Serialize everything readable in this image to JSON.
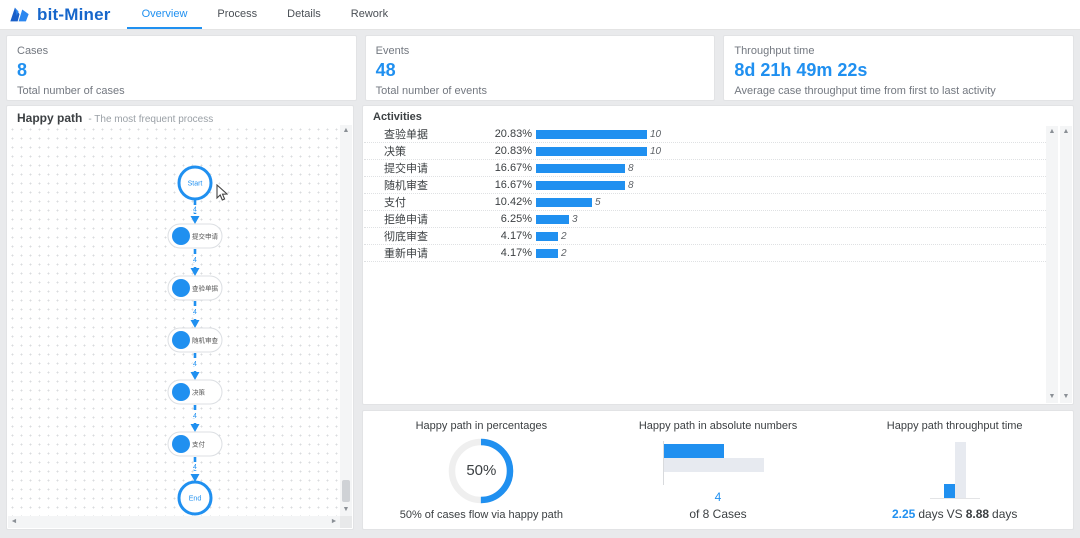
{
  "colors": {
    "accent": "#2090f0",
    "logo": "#1666cb",
    "bar_gray": "#e7eaf0"
  },
  "header": {
    "logo_text": "bit-Miner",
    "tabs": [
      {
        "label": "Overview",
        "active": true
      },
      {
        "label": "Process",
        "active": false
      },
      {
        "label": "Details",
        "active": false
      },
      {
        "label": "Rework",
        "active": false
      }
    ]
  },
  "summary_cards": [
    {
      "label": "Cases",
      "value": "8",
      "description": "Total number of cases"
    },
    {
      "label": "Events",
      "value": "48",
      "description": "Total number of events"
    },
    {
      "label": "Throughput time",
      "value": "8d 21h 49m 22s",
      "description": "Average case throughput time from first to last activity"
    }
  ],
  "happy_path": {
    "title": "Happy path",
    "subtitle": "- The most frequent process",
    "edge_label": "4",
    "nodes": [
      "Start",
      "提交申请",
      "查验单据",
      "随机审查",
      "决策",
      "支付",
      "End"
    ]
  },
  "activities": {
    "title": "Activities",
    "rows": [
      {
        "label": "查验单据",
        "percent": "20.83%",
        "value": 10
      },
      {
        "label": "决策",
        "percent": "20.83%",
        "value": 10
      },
      {
        "label": "提交申请",
        "percent": "16.67%",
        "value": 8
      },
      {
        "label": "随机审查",
        "percent": "16.67%",
        "value": 8
      },
      {
        "label": "支付",
        "percent": "10.42%",
        "value": 5
      },
      {
        "label": "拒绝申请",
        "percent": "6.25%",
        "value": 3
      },
      {
        "label": "彻底审查",
        "percent": "4.17%",
        "value": 2
      },
      {
        "label": "重新申请",
        "percent": "4.17%",
        "value": 2
      }
    ]
  },
  "happy_path_stats": {
    "percentages": {
      "title": "Happy path in percentages",
      "percent": 50,
      "center_label": "50%",
      "caption": "50% of cases flow via happy path"
    },
    "absolute": {
      "title": "Happy path in absolute numbers",
      "happy": 4,
      "total": 8,
      "value_label": "4",
      "caption": "of 8 Cases"
    },
    "throughput": {
      "title": "Happy path throughput time",
      "happy_days": "2.25",
      "total_days": "8.88",
      "unit": "days",
      "vs": "VS"
    }
  },
  "chart_data": [
    {
      "type": "bar",
      "title": "Activities",
      "orientation": "horizontal",
      "categories": [
        "查验单据",
        "决策",
        "提交申请",
        "随机审查",
        "支付",
        "拒绝申请",
        "彻底审查",
        "重新申请"
      ],
      "values": [
        10,
        10,
        8,
        8,
        5,
        3,
        2,
        2
      ],
      "percent_labels": [
        "20.83%",
        "20.83%",
        "16.67%",
        "16.67%",
        "10.42%",
        "6.25%",
        "4.17%",
        "4.17%"
      ]
    },
    {
      "type": "pie",
      "title": "Happy path in percentages",
      "categories": [
        "happy path",
        "other"
      ],
      "values": [
        50,
        50
      ],
      "center_label": "50%"
    },
    {
      "type": "bar",
      "title": "Happy path in absolute numbers",
      "orientation": "horizontal",
      "categories": [
        "happy path cases",
        "total cases"
      ],
      "values": [
        4,
        8
      ]
    },
    {
      "type": "bar",
      "title": "Happy path throughput time",
      "orientation": "vertical",
      "categories": [
        "happy path",
        "all cases"
      ],
      "values": [
        2.25,
        8.88
      ],
      "unit": "days"
    }
  ]
}
